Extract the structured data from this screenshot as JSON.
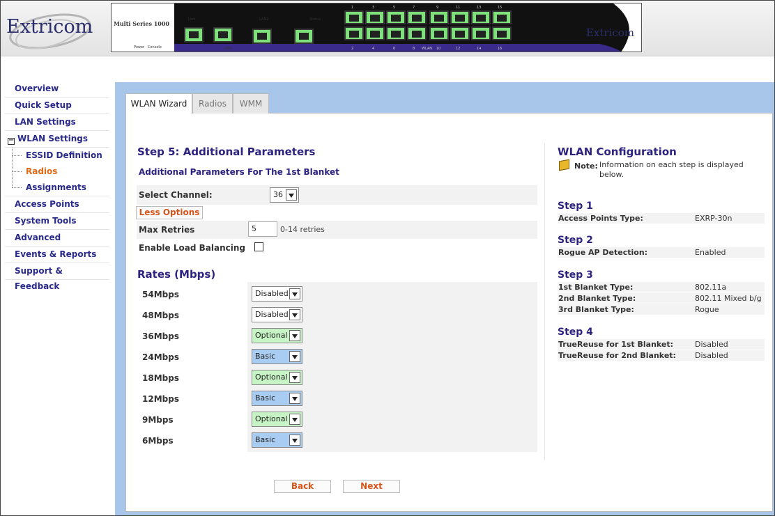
{
  "header": {
    "logo": "Extricom",
    "device_model": "Multi Series 1000",
    "device_brand": "Extricom",
    "device_labels": {
      "power": "Power",
      "console": "Console",
      "lan1": "LAN1",
      "lan2": "LAN2",
      "status": "Status",
      "wlan": "WLAN",
      "ports_top": [
        "1",
        "3",
        "5",
        "7",
        "9",
        "11",
        "13",
        "15"
      ],
      "ports_bottom": [
        "2",
        "4",
        "6",
        "8",
        "10",
        "12",
        "14",
        "16"
      ]
    }
  },
  "sidebar": {
    "items": [
      {
        "label": "Overview"
      },
      {
        "label": "Quick Setup"
      },
      {
        "label": "LAN Settings"
      },
      {
        "label": "WLAN Settings",
        "expanded_glyph": "−"
      },
      {
        "label": "Access Points"
      },
      {
        "label": "System Tools"
      },
      {
        "label": "Advanced"
      },
      {
        "label": "Events & Reports"
      },
      {
        "label": "Support & Feedback"
      }
    ],
    "wlan_sub": [
      {
        "label": "ESSID Definition"
      },
      {
        "label": "Radios",
        "active": true
      },
      {
        "label": "Assignments"
      }
    ]
  },
  "tabs": [
    {
      "label": "WLAN Wizard",
      "active": true
    },
    {
      "label": "Radios"
    },
    {
      "label": "WMM"
    }
  ],
  "wizard": {
    "step_title": "Step 5: Additional Parameters",
    "sub_title": "Additional Parameters For The 1st Blanket",
    "channel_label": "Select Channel:",
    "channel_value": "36",
    "less_options_label": "Less Options",
    "max_retries_label": "Max Retries",
    "max_retries_value": "5",
    "max_retries_hint": "0-14 retries",
    "load_balancing_label": "Enable Load Balancing",
    "load_balancing_checked": false,
    "rates_title": "Rates (Mbps)",
    "rates": [
      {
        "label": "54Mbps",
        "value": "Disabled",
        "kind": "disabled"
      },
      {
        "label": "48Mbps",
        "value": "Disabled",
        "kind": "disabled"
      },
      {
        "label": "36Mbps",
        "value": "Optional",
        "kind": "optional"
      },
      {
        "label": "24Mbps",
        "value": "Basic",
        "kind": "basic"
      },
      {
        "label": "18Mbps",
        "value": "Optional",
        "kind": "optional"
      },
      {
        "label": "12Mbps",
        "value": "Basic",
        "kind": "basic"
      },
      {
        "label": "9Mbps",
        "value": "Optional",
        "kind": "optional"
      },
      {
        "label": "6Mbps",
        "value": "Basic",
        "kind": "basic"
      }
    ],
    "back_label": "Back",
    "next_label": "Next"
  },
  "config": {
    "title": "WLAN Configuration",
    "note_label": "Note:",
    "note_text": "Information on each step is displayed below.",
    "steps": [
      {
        "title": "Step 1",
        "rows": [
          {
            "k": "Access Points Type:",
            "v": "EXRP-30n"
          }
        ]
      },
      {
        "title": "Step 2",
        "rows": [
          {
            "k": "Rogue AP Detection:",
            "v": "Enabled"
          }
        ]
      },
      {
        "title": "Step 3",
        "rows": [
          {
            "k": "1st Blanket Type:",
            "v": "802.11a"
          },
          {
            "k": "2nd Blanket Type:",
            "v": "802.11 Mixed b/g"
          },
          {
            "k": "3rd Blanket Type:",
            "v": "Rogue"
          }
        ]
      },
      {
        "title": "Step 4",
        "rows": [
          {
            "k": "TrueReuse for 1st Blanket:",
            "v": "Disabled"
          },
          {
            "k": "TrueReuse for 2nd Blanket:",
            "v": "Disabled"
          }
        ]
      }
    ]
  },
  "colors": {
    "nav_text": "#2a2a8a",
    "nav_active": "#e06a18",
    "heading": "#2c2380",
    "main_background": "#a8c6ea",
    "optional_fill": "#c7f4c4",
    "basic_fill": "#a9cdf2",
    "button_text": "#d4551a"
  }
}
